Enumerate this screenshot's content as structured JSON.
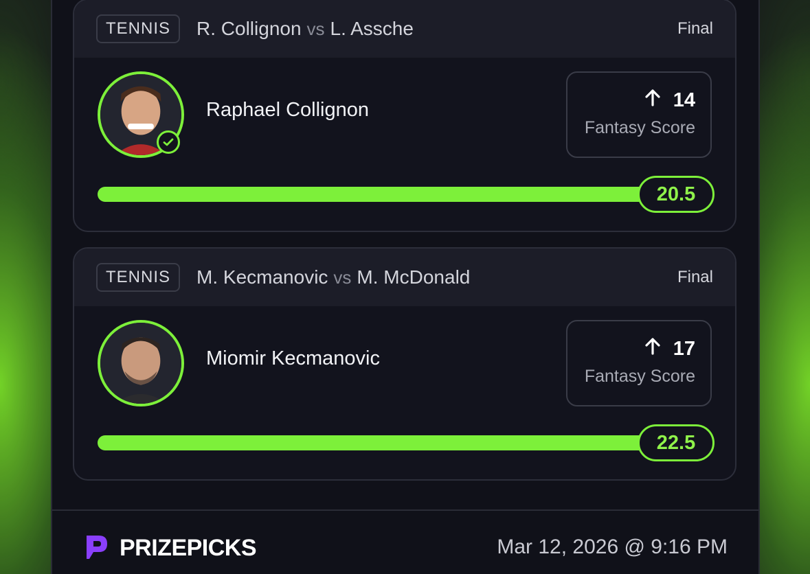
{
  "picks": [
    {
      "sport": "TENNIS",
      "team_a": "R. Collignon",
      "vs": "vs",
      "team_b": "L. Assche",
      "status": "Final",
      "player": "Raphael Collignon",
      "result_score": "14",
      "score_label": "Fantasy Score",
      "line": "20.5",
      "progress_pct": 100,
      "verified": true
    },
    {
      "sport": "TENNIS",
      "team_a": "M. Kecmanovic",
      "vs": "vs",
      "team_b": "M. McDonald",
      "status": "Final",
      "player": "Miomir Kecmanovic",
      "result_score": "17",
      "score_label": "Fantasy Score",
      "line": "22.5",
      "progress_pct": 100,
      "verified": false
    }
  ],
  "footer": {
    "brand": "PRIZEPICKS",
    "datetime": "Mar 12, 2026 @ 9:16 PM"
  },
  "colors": {
    "accent": "#7df03a",
    "brand_purple": "#8a3ffc",
    "panel": "#101119"
  }
}
